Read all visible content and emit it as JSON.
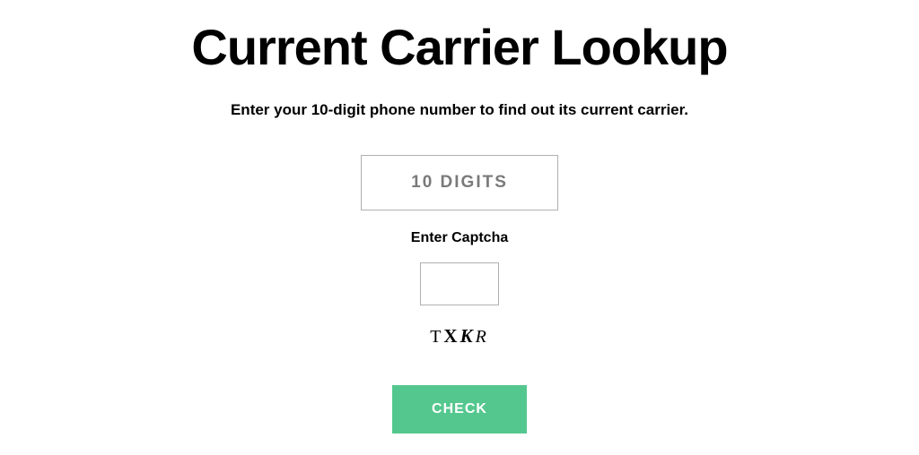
{
  "header": {
    "title": "Current Carrier Lookup",
    "subtitle": "Enter your 10-digit phone number to find out its current carrier."
  },
  "form": {
    "phone_placeholder": "10 DIGITS",
    "phone_value": "",
    "captcha_label": "Enter Captcha",
    "captcha_value": "",
    "captcha_chars": {
      "c1": "T",
      "c2": "X",
      "c3": "K",
      "c4": "R"
    },
    "submit_label": "CHECK"
  },
  "colors": {
    "accent": "#54c78e"
  }
}
